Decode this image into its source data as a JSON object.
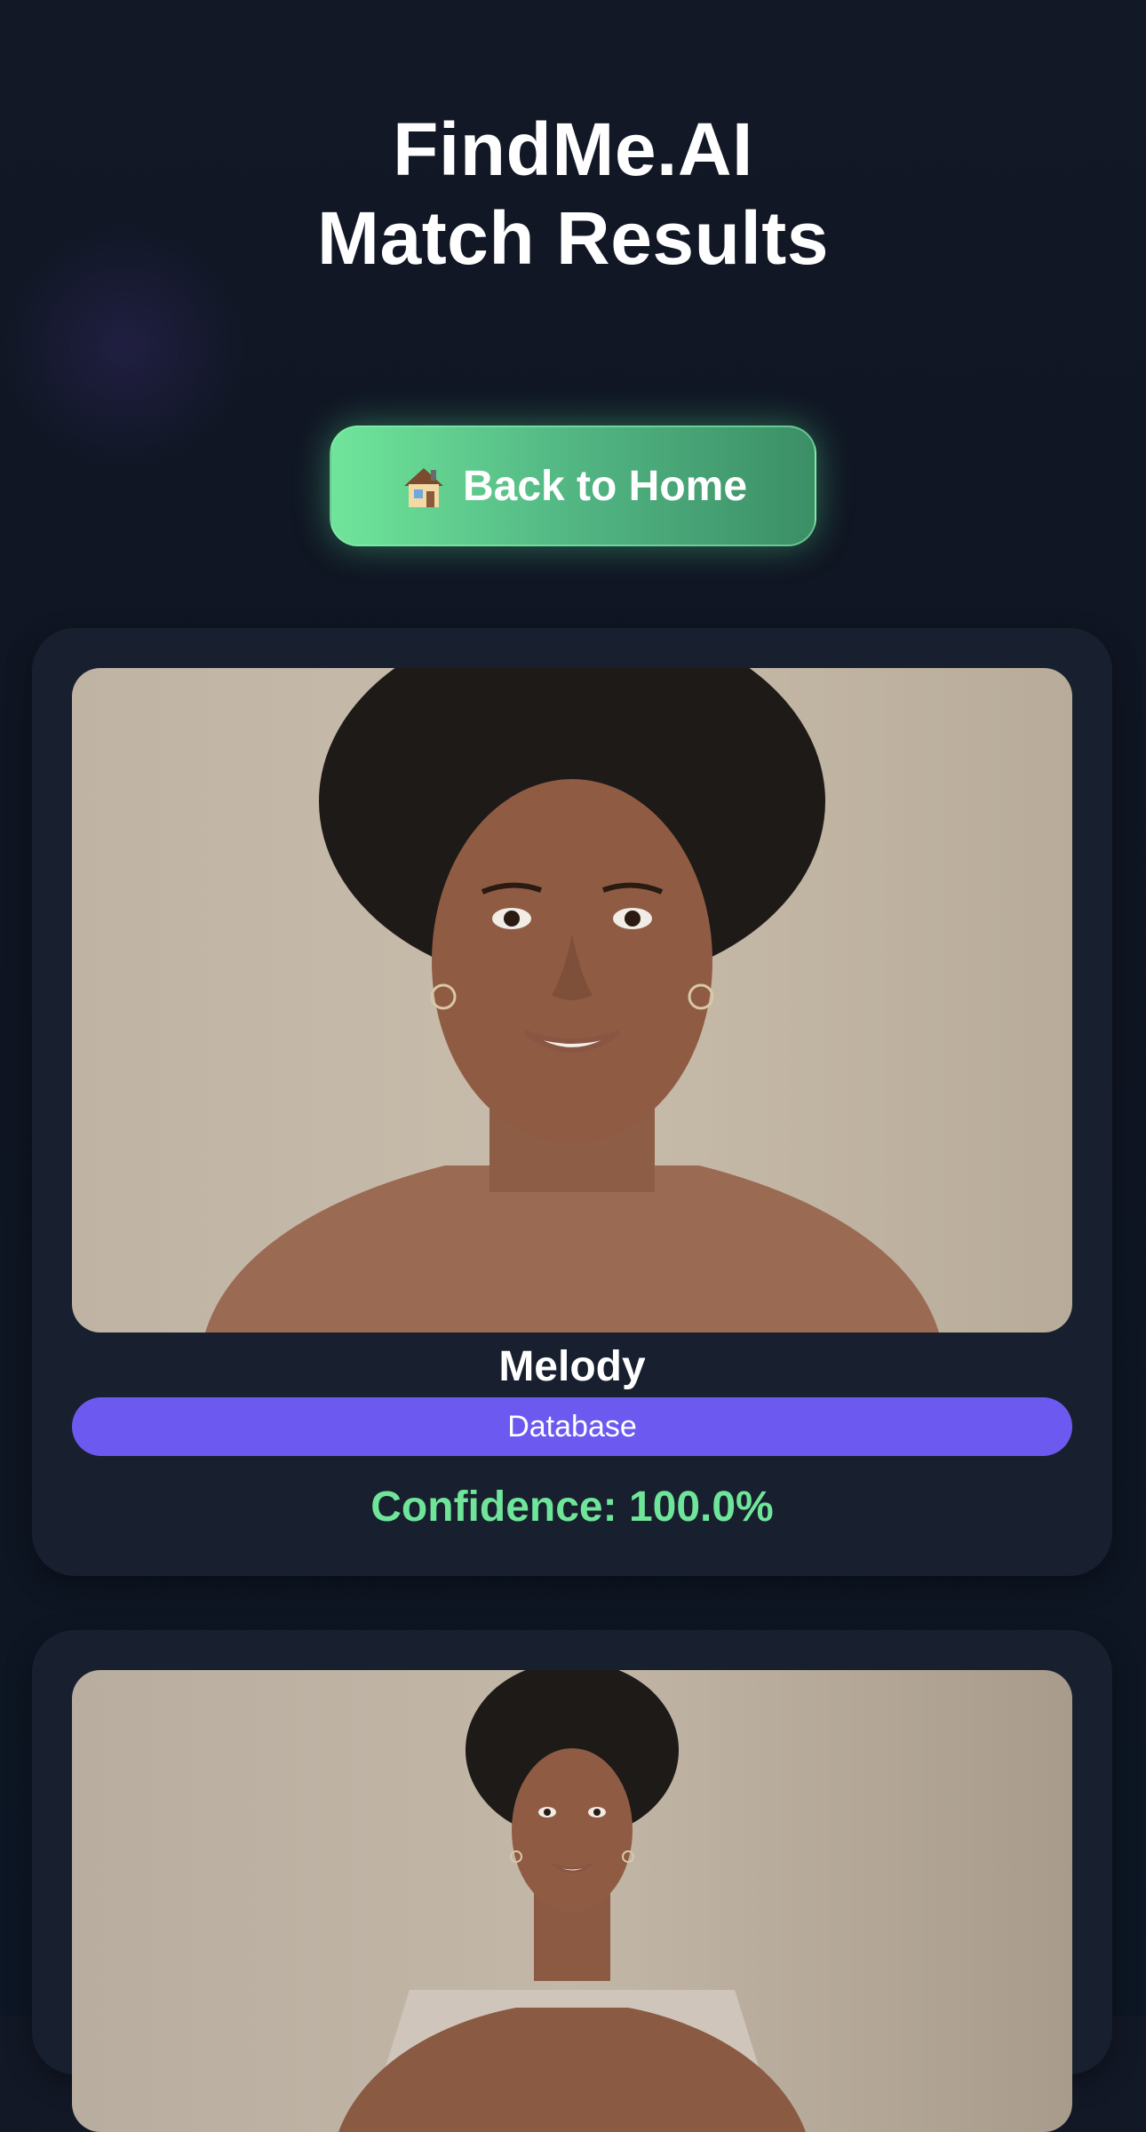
{
  "header": {
    "title_line1": "FindMe.AI",
    "title_line2": "Match Results"
  },
  "back_button": {
    "icon": "house-icon",
    "label": "Back to Home"
  },
  "results": [
    {
      "name": "Melody",
      "source": "Database",
      "confidence": "Confidence: 100.0%",
      "photo": "portrait-photo"
    },
    {
      "photo": "portrait-photo"
    }
  ],
  "colors": {
    "background": "#111827",
    "card": "#18202f",
    "button_green": "#52b683",
    "badge_purple": "#6c5af0",
    "confidence_green": "#6fe59a"
  }
}
